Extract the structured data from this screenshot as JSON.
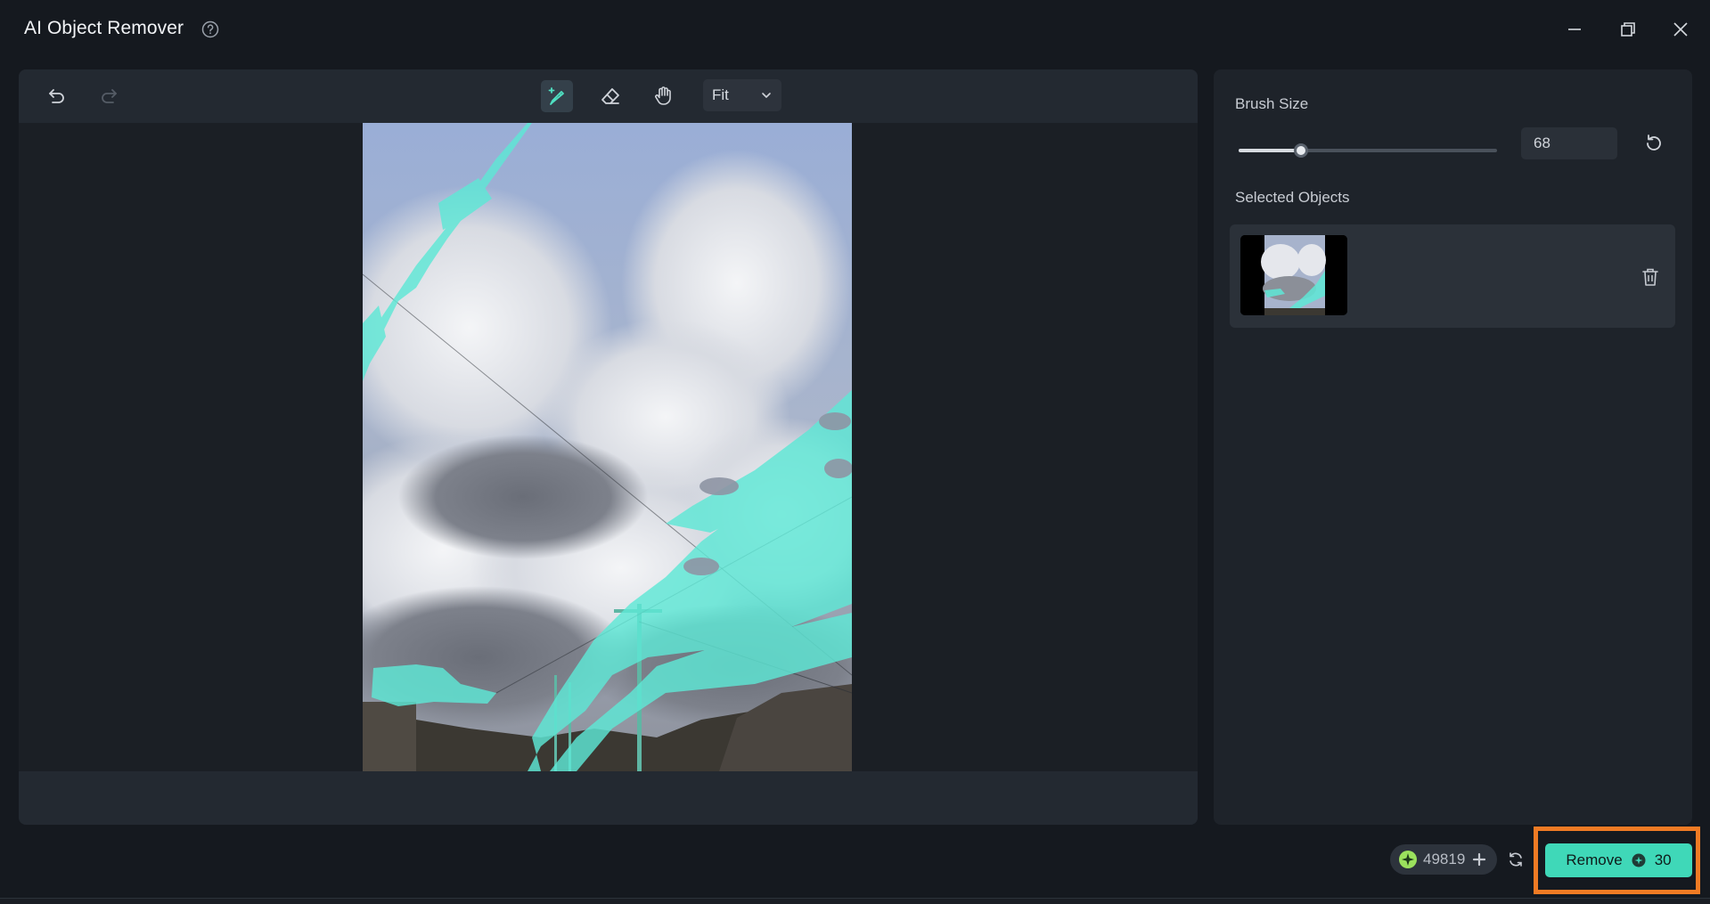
{
  "window": {
    "title": "AI Object Remover",
    "icons": {
      "help": "help-circle-icon",
      "minimize": "minimize-icon",
      "maximize": "restore-icon",
      "close": "close-icon"
    }
  },
  "toolbar": {
    "tools": [
      "undo-icon",
      "redo-icon",
      "smart-brush-icon",
      "eraser-icon",
      "hand-icon"
    ],
    "active_tool": "smart-brush",
    "zoom": {
      "selected": "Fit"
    }
  },
  "brush": {
    "label": "Brush Size",
    "value": "68",
    "slider_fraction": 0.24
  },
  "selected_objects": {
    "label": "Selected Objects",
    "count": 1
  },
  "footer": {
    "credits": "49819",
    "remove_label": "Remove",
    "remove_cost": "30"
  },
  "colors": {
    "accent": "#3fd8b8",
    "mask": "#5ee8d6",
    "highlight": "#f07b24",
    "background": "#15191f",
    "panel": "#1e232a"
  }
}
